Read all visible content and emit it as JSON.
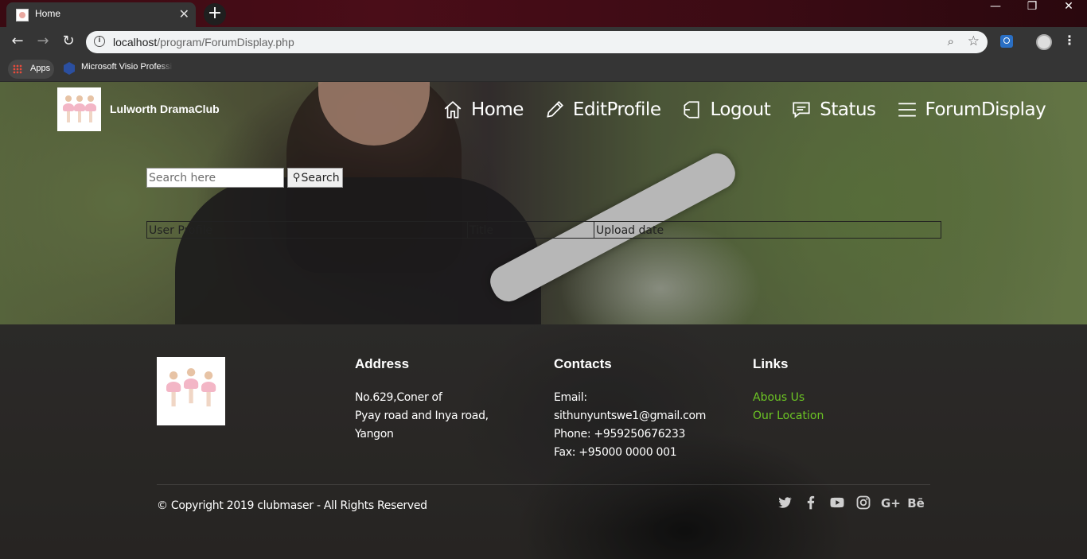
{
  "browser": {
    "tab_title": "Home",
    "tab_close": "✕",
    "new_tab": "+",
    "url_host": "localhost",
    "url_path": "/program/ForumDisplay.php",
    "bookmarks": [
      {
        "label": "Apps",
        "icon": "apps-grid-icon"
      },
      {
        "label": "Microsoft Visio Professi",
        "icon": "visio-icon"
      }
    ]
  },
  "header": {
    "site_name": "Lulworth DramaClub",
    "nav": [
      {
        "label": "Home",
        "icon": "home-icon"
      },
      {
        "label": "EditProfile",
        "icon": "pencil-icon"
      },
      {
        "label": "Logout",
        "icon": "logout-icon"
      },
      {
        "label": "Status",
        "icon": "chat-icon"
      },
      {
        "label": "ForumDisplay",
        "icon": "menu-lines-icon"
      }
    ]
  },
  "search": {
    "placeholder": "Search here",
    "button_label": "Search"
  },
  "table": {
    "headers": [
      "User Profile",
      "Title",
      "Upload date"
    ]
  },
  "footer": {
    "address": {
      "heading": "Address",
      "lines": [
        "No.629,Coner of",
        "Pyay road and Inya road,",
        "Yangon"
      ]
    },
    "contacts": {
      "heading": "Contacts",
      "lines": [
        "Email:",
        "sithunyuntswe1@gmail.com",
        "Phone: +959250676233",
        "Fax: +95000 0000 001"
      ]
    },
    "links": {
      "heading": "Links",
      "items": [
        "Abous Us",
        "Our Location"
      ],
      "color": "#6cc524"
    },
    "copyright": "© Copyright 2019 clubmaser - All Rights Reserved",
    "social": [
      "twitter-icon",
      "facebook-icon",
      "youtube-icon",
      "instagram-icon",
      "google-plus-icon",
      "behance-icon"
    ]
  }
}
